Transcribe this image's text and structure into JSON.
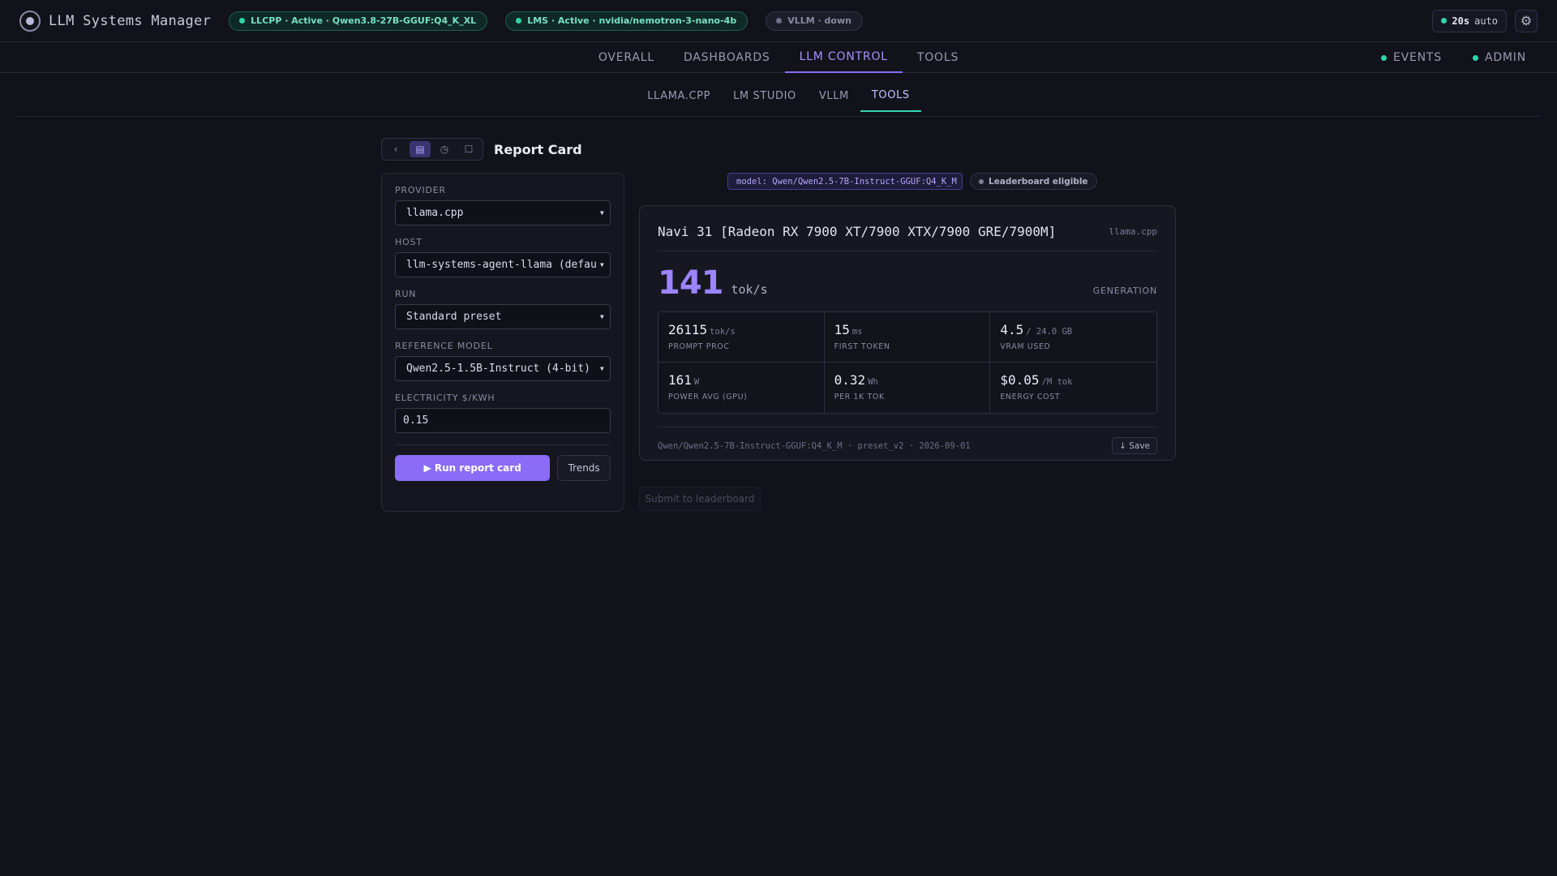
{
  "app": {
    "title": "LLM Systems Manager"
  },
  "status_pills": [
    {
      "label": "LLCPP · Active · Qwen3.8-27B-GGUF:Q4_K_XL",
      "state": "ok"
    },
    {
      "label": "LMS · Active · nvidia/nemotron-3-nano-4b",
      "state": "ok"
    },
    {
      "label": "VLLM · down",
      "state": "off"
    }
  ],
  "refresh": {
    "interval": "20s",
    "mode": "auto"
  },
  "main_nav": {
    "tabs": [
      "OVERALL",
      "DASHBOARDS",
      "LLM CONTROL",
      "TOOLS"
    ],
    "active": "LLM CONTROL",
    "right": [
      "EVENTS",
      "ADMIN"
    ]
  },
  "sub_nav": {
    "tabs": [
      "LLAMA.CPP",
      "LM STUDIO",
      "VLLM",
      "TOOLS"
    ],
    "active": "TOOLS"
  },
  "report": {
    "title": "Report Card",
    "icons": [
      "chevron-left-icon",
      "grid-icon",
      "clock-icon",
      "square-icon"
    ]
  },
  "form": {
    "provider": {
      "label": "PROVIDER",
      "value": "llama.cpp"
    },
    "host": {
      "label": "HOST",
      "value": "llm-systems-agent-llama (defau"
    },
    "run": {
      "label": "RUN",
      "value": "Standard preset"
    },
    "reference_model": {
      "label": "REFERENCE MODEL",
      "value": "Qwen2.5-1.5B-Instruct (4-bit)"
    },
    "electricity": {
      "label": "ELECTRICITY $/KWH",
      "value": "0.15"
    },
    "run_button": "▶ Run report card",
    "trends_button": "Trends"
  },
  "badges": {
    "model": "model: Qwen/Qwen2.5-7B-Instruct-GGUF:Q4_K_M",
    "leaderboard": "Leaderboard eligible"
  },
  "card": {
    "gpu": "Navi 31 [Radeon RX 7900 XT/7900 XTX/7900 GRE/7900M]",
    "provider": "llama.cpp",
    "generation": {
      "value": "141",
      "unit": "tok/s",
      "label": "GENERATION"
    },
    "metrics": [
      {
        "value": "26115",
        "unit": "tok/s",
        "label": "PROMPT PROC"
      },
      {
        "value": "15",
        "unit": "ms",
        "label": "FIRST TOKEN"
      },
      {
        "value": "4.5",
        "unit": "/ 24.0 GB",
        "label": "VRAM USED"
      },
      {
        "value": "161",
        "unit": "W",
        "label": "POWER AVG (GPU)"
      },
      {
        "value": "0.32",
        "unit": "Wh",
        "label": "PER 1K TOK"
      },
      {
        "value": "$0.05",
        "unit": "/M tok",
        "label": "ENERGY COST"
      }
    ],
    "meta": "Qwen/Qwen2.5-7B-Instruct-GGUF:Q4_K_M · preset_v2 · 2026-09-01",
    "save_button": "↓ Save"
  },
  "submit_button": "Submit to leaderboard"
}
